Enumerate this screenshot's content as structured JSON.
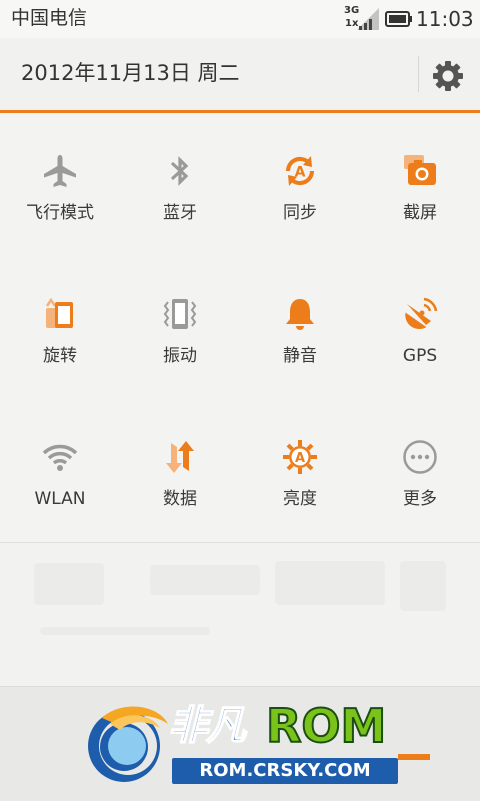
{
  "status_bar": {
    "carrier": "中国电信",
    "network_top": "3G",
    "network_bottom": "1x",
    "time": "11:03"
  },
  "header": {
    "date": "2012年11月13日 周二",
    "settings_icon": "gear-icon"
  },
  "toggles": [
    {
      "label": "飞行模式",
      "icon": "airplane-icon",
      "state": "off"
    },
    {
      "label": "蓝牙",
      "icon": "bluetooth-icon",
      "state": "off"
    },
    {
      "label": "同步",
      "icon": "sync-icon",
      "state": "on"
    },
    {
      "label": "截屏",
      "icon": "screenshot-icon",
      "state": "on"
    },
    {
      "label": "旋转",
      "icon": "rotate-icon",
      "state": "on"
    },
    {
      "label": "振动",
      "icon": "vibrate-icon",
      "state": "off"
    },
    {
      "label": "静音",
      "icon": "bell-icon",
      "state": "on"
    },
    {
      "label": "GPS",
      "icon": "gps-icon",
      "state": "on"
    },
    {
      "label": "WLAN",
      "icon": "wifi-icon",
      "state": "off"
    },
    {
      "label": "数据",
      "icon": "data-icon",
      "state": "on"
    },
    {
      "label": "亮度",
      "icon": "brightness-icon",
      "state": "on"
    },
    {
      "label": "更多",
      "icon": "more-icon",
      "state": "off"
    }
  ],
  "colors": {
    "accent": "#ec7d1a",
    "inactive": "#9a9a9a",
    "background": "#f3f3f1"
  },
  "watermark": {
    "cn_text": "非凡",
    "rom_text": "ROM",
    "url": "ROM.CRSKY.COM"
  }
}
